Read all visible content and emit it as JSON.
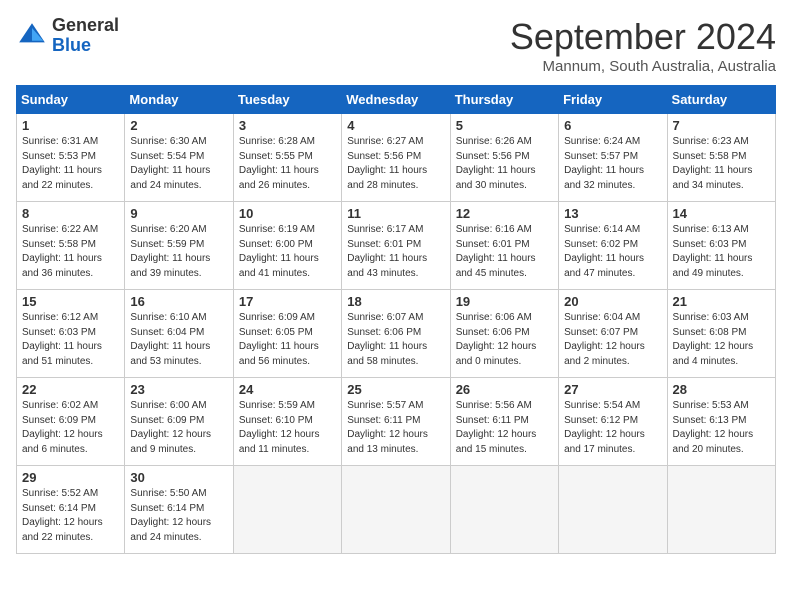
{
  "header": {
    "logo_general": "General",
    "logo_blue": "Blue",
    "month_title": "September 2024",
    "location": "Mannum, South Australia, Australia"
  },
  "weekdays": [
    "Sunday",
    "Monday",
    "Tuesday",
    "Wednesday",
    "Thursday",
    "Friday",
    "Saturday"
  ],
  "weeks": [
    [
      {
        "day": "1",
        "info": "Sunrise: 6:31 AM\nSunset: 5:53 PM\nDaylight: 11 hours\nand 22 minutes."
      },
      {
        "day": "2",
        "info": "Sunrise: 6:30 AM\nSunset: 5:54 PM\nDaylight: 11 hours\nand 24 minutes."
      },
      {
        "day": "3",
        "info": "Sunrise: 6:28 AM\nSunset: 5:55 PM\nDaylight: 11 hours\nand 26 minutes."
      },
      {
        "day": "4",
        "info": "Sunrise: 6:27 AM\nSunset: 5:56 PM\nDaylight: 11 hours\nand 28 minutes."
      },
      {
        "day": "5",
        "info": "Sunrise: 6:26 AM\nSunset: 5:56 PM\nDaylight: 11 hours\nand 30 minutes."
      },
      {
        "day": "6",
        "info": "Sunrise: 6:24 AM\nSunset: 5:57 PM\nDaylight: 11 hours\nand 32 minutes."
      },
      {
        "day": "7",
        "info": "Sunrise: 6:23 AM\nSunset: 5:58 PM\nDaylight: 11 hours\nand 34 minutes."
      }
    ],
    [
      {
        "day": "8",
        "info": "Sunrise: 6:22 AM\nSunset: 5:58 PM\nDaylight: 11 hours\nand 36 minutes."
      },
      {
        "day": "9",
        "info": "Sunrise: 6:20 AM\nSunset: 5:59 PM\nDaylight: 11 hours\nand 39 minutes."
      },
      {
        "day": "10",
        "info": "Sunrise: 6:19 AM\nSunset: 6:00 PM\nDaylight: 11 hours\nand 41 minutes."
      },
      {
        "day": "11",
        "info": "Sunrise: 6:17 AM\nSunset: 6:01 PM\nDaylight: 11 hours\nand 43 minutes."
      },
      {
        "day": "12",
        "info": "Sunrise: 6:16 AM\nSunset: 6:01 PM\nDaylight: 11 hours\nand 45 minutes."
      },
      {
        "day": "13",
        "info": "Sunrise: 6:14 AM\nSunset: 6:02 PM\nDaylight: 11 hours\nand 47 minutes."
      },
      {
        "day": "14",
        "info": "Sunrise: 6:13 AM\nSunset: 6:03 PM\nDaylight: 11 hours\nand 49 minutes."
      }
    ],
    [
      {
        "day": "15",
        "info": "Sunrise: 6:12 AM\nSunset: 6:03 PM\nDaylight: 11 hours\nand 51 minutes."
      },
      {
        "day": "16",
        "info": "Sunrise: 6:10 AM\nSunset: 6:04 PM\nDaylight: 11 hours\nand 53 minutes."
      },
      {
        "day": "17",
        "info": "Sunrise: 6:09 AM\nSunset: 6:05 PM\nDaylight: 11 hours\nand 56 minutes."
      },
      {
        "day": "18",
        "info": "Sunrise: 6:07 AM\nSunset: 6:06 PM\nDaylight: 11 hours\nand 58 minutes."
      },
      {
        "day": "19",
        "info": "Sunrise: 6:06 AM\nSunset: 6:06 PM\nDaylight: 12 hours\nand 0 minutes."
      },
      {
        "day": "20",
        "info": "Sunrise: 6:04 AM\nSunset: 6:07 PM\nDaylight: 12 hours\nand 2 minutes."
      },
      {
        "day": "21",
        "info": "Sunrise: 6:03 AM\nSunset: 6:08 PM\nDaylight: 12 hours\nand 4 minutes."
      }
    ],
    [
      {
        "day": "22",
        "info": "Sunrise: 6:02 AM\nSunset: 6:09 PM\nDaylight: 12 hours\nand 6 minutes."
      },
      {
        "day": "23",
        "info": "Sunrise: 6:00 AM\nSunset: 6:09 PM\nDaylight: 12 hours\nand 9 minutes."
      },
      {
        "day": "24",
        "info": "Sunrise: 5:59 AM\nSunset: 6:10 PM\nDaylight: 12 hours\nand 11 minutes."
      },
      {
        "day": "25",
        "info": "Sunrise: 5:57 AM\nSunset: 6:11 PM\nDaylight: 12 hours\nand 13 minutes."
      },
      {
        "day": "26",
        "info": "Sunrise: 5:56 AM\nSunset: 6:11 PM\nDaylight: 12 hours\nand 15 minutes."
      },
      {
        "day": "27",
        "info": "Sunrise: 5:54 AM\nSunset: 6:12 PM\nDaylight: 12 hours\nand 17 minutes."
      },
      {
        "day": "28",
        "info": "Sunrise: 5:53 AM\nSunset: 6:13 PM\nDaylight: 12 hours\nand 20 minutes."
      }
    ],
    [
      {
        "day": "29",
        "info": "Sunrise: 5:52 AM\nSunset: 6:14 PM\nDaylight: 12 hours\nand 22 minutes."
      },
      {
        "day": "30",
        "info": "Sunrise: 5:50 AM\nSunset: 6:14 PM\nDaylight: 12 hours\nand 24 minutes."
      },
      {
        "day": "",
        "info": ""
      },
      {
        "day": "",
        "info": ""
      },
      {
        "day": "",
        "info": ""
      },
      {
        "day": "",
        "info": ""
      },
      {
        "day": "",
        "info": ""
      }
    ]
  ]
}
